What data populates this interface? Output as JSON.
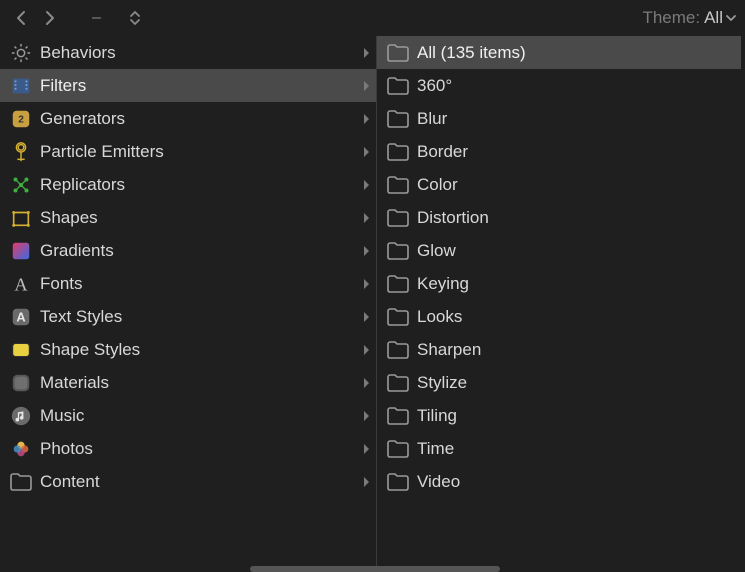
{
  "toolbar": {
    "theme_label": "Theme:",
    "theme_value": "All"
  },
  "left": {
    "items": [
      {
        "label": "Behaviors",
        "icon": "gear-icon",
        "selected": false
      },
      {
        "label": "Filters",
        "icon": "filmstrip-icon",
        "selected": true
      },
      {
        "label": "Generators",
        "icon": "generator-icon",
        "selected": false
      },
      {
        "label": "Particle Emitters",
        "icon": "emitter-icon",
        "selected": false
      },
      {
        "label": "Replicators",
        "icon": "replicator-icon",
        "selected": false
      },
      {
        "label": "Shapes",
        "icon": "shapes-icon",
        "selected": false
      },
      {
        "label": "Gradients",
        "icon": "gradients-icon",
        "selected": false
      },
      {
        "label": "Fonts",
        "icon": "fonts-icon",
        "selected": false
      },
      {
        "label": "Text Styles",
        "icon": "textstyles-icon",
        "selected": false
      },
      {
        "label": "Shape Styles",
        "icon": "shapestyles-icon",
        "selected": false
      },
      {
        "label": "Materials",
        "icon": "materials-icon",
        "selected": false
      },
      {
        "label": "Music",
        "icon": "music-icon",
        "selected": false
      },
      {
        "label": "Photos",
        "icon": "photos-icon",
        "selected": false
      },
      {
        "label": "Content",
        "icon": "folder-icon",
        "selected": false
      }
    ]
  },
  "right": {
    "items": [
      {
        "label": "All (135 items)",
        "selected": true
      },
      {
        "label": "360°",
        "selected": false
      },
      {
        "label": "Blur",
        "selected": false
      },
      {
        "label": "Border",
        "selected": false
      },
      {
        "label": "Color",
        "selected": false
      },
      {
        "label": "Distortion",
        "selected": false
      },
      {
        "label": "Glow",
        "selected": false
      },
      {
        "label": "Keying",
        "selected": false
      },
      {
        "label": "Looks",
        "selected": false
      },
      {
        "label": "Sharpen",
        "selected": false
      },
      {
        "label": "Stylize",
        "selected": false
      },
      {
        "label": "Tiling",
        "selected": false
      },
      {
        "label": "Time",
        "selected": false
      },
      {
        "label": "Video",
        "selected": false
      }
    ]
  }
}
